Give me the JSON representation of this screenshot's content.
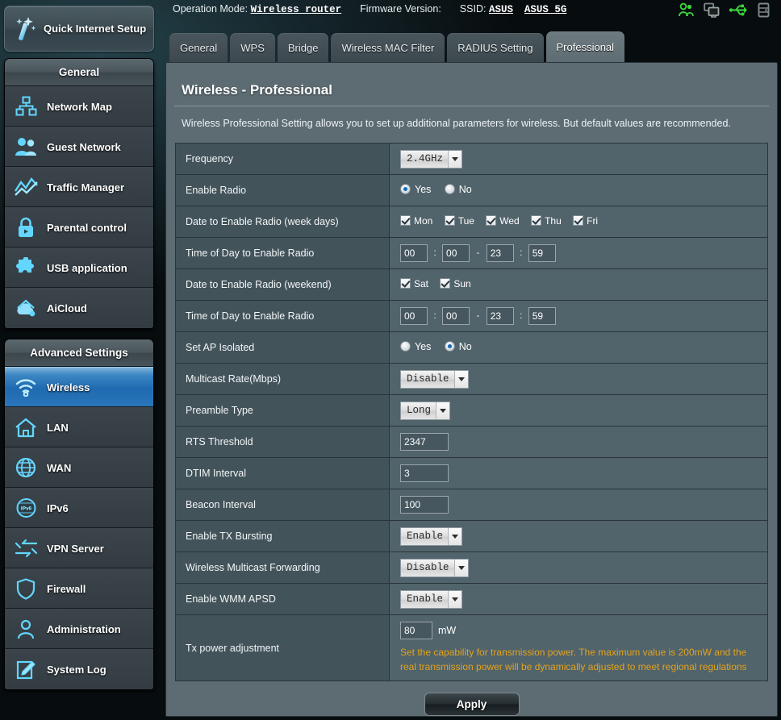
{
  "sidebar": {
    "quick_setup": {
      "label": "Quick Internet Setup",
      "icon": "magic-wand-icon"
    },
    "groups": [
      {
        "title": "General",
        "items": [
          {
            "label": "Network Map",
            "icon": "network-map-icon",
            "active": false
          },
          {
            "label": "Guest Network",
            "icon": "guest-users-icon",
            "active": false
          },
          {
            "label": "Traffic Manager",
            "icon": "traffic-chart-icon",
            "active": false
          },
          {
            "label": "Parental control",
            "icon": "padlock-icon",
            "active": false
          },
          {
            "label": "USB application",
            "icon": "puzzle-piece-icon",
            "active": false
          },
          {
            "label": "AiCloud",
            "icon": "cloud-house-icon",
            "active": false
          }
        ]
      },
      {
        "title": "Advanced Settings",
        "items": [
          {
            "label": "Wireless",
            "icon": "wifi-signal-icon",
            "active": true
          },
          {
            "label": "LAN",
            "icon": "house-icon",
            "active": false
          },
          {
            "label": "WAN",
            "icon": "globe-icon",
            "active": false
          },
          {
            "label": "IPv6",
            "icon": "ipv6-globe-icon",
            "active": false
          },
          {
            "label": "VPN Server",
            "icon": "vpn-arrows-icon",
            "active": false
          },
          {
            "label": "Firewall",
            "icon": "shield-icon",
            "active": false
          },
          {
            "label": "Administration",
            "icon": "user-badge-icon",
            "active": false
          },
          {
            "label": "System Log",
            "icon": "log-pencil-icon",
            "active": false
          }
        ]
      }
    ]
  },
  "header": {
    "operation_mode_label": "Operation Mode:",
    "operation_mode_value": "Wireless router",
    "firmware_label": "Firmware Version:",
    "firmware_value": "",
    "ssid_label": "SSID:",
    "ssid_value_1": "ASUS",
    "ssid_value_2": "ASUS_5G",
    "icons": [
      {
        "name": "clients-users-icon",
        "color": "#3bd33b"
      },
      {
        "name": "network-clients-icon",
        "color": "#7e8a8a"
      },
      {
        "name": "usb-icon",
        "color": "#3bd33b"
      },
      {
        "name": "printer-icon",
        "color": "#7e8a8a"
      }
    ]
  },
  "tabs": [
    {
      "label": "General",
      "active": false
    },
    {
      "label": "WPS",
      "active": false
    },
    {
      "label": "Bridge",
      "active": false
    },
    {
      "label": "Wireless MAC Filter",
      "active": false
    },
    {
      "label": "RADIUS Setting",
      "active": false
    },
    {
      "label": "Professional",
      "active": true
    }
  ],
  "page": {
    "title": "Wireless - Professional",
    "description": "Wireless Professional Setting allows you to set up additional parameters for wireless. But default values are recommended."
  },
  "form": {
    "frequency": {
      "label": "Frequency",
      "value": "2.4GHz"
    },
    "enable_radio": {
      "label": "Enable Radio",
      "yes": "Yes",
      "no": "No",
      "selected": "Yes"
    },
    "date_weekdays": {
      "label": "Date to Enable Radio (week days)",
      "days": [
        {
          "label": "Mon",
          "checked": true
        },
        {
          "label": "Tue",
          "checked": true
        },
        {
          "label": "Wed",
          "checked": true
        },
        {
          "label": "Thu",
          "checked": true
        },
        {
          "label": "Fri",
          "checked": true
        }
      ]
    },
    "time_weekdays": {
      "label": "Time of Day to Enable Radio",
      "start_h": "00",
      "start_m": "00",
      "end_h": "23",
      "end_m": "59",
      "colon": ":",
      "dash": "-"
    },
    "date_weekend": {
      "label": "Date to Enable Radio (weekend)",
      "days": [
        {
          "label": "Sat",
          "checked": true
        },
        {
          "label": "Sun",
          "checked": true
        }
      ]
    },
    "time_weekend": {
      "label": "Time of Day to Enable Radio",
      "start_h": "00",
      "start_m": "00",
      "end_h": "23",
      "end_m": "59",
      "colon": ":",
      "dash": "-"
    },
    "ap_isolated": {
      "label": "Set AP Isolated",
      "yes": "Yes",
      "no": "No",
      "selected": "No"
    },
    "multicast_rate": {
      "label": "Multicast Rate(Mbps)",
      "value": "Disable"
    },
    "preamble_type": {
      "label": "Preamble Type",
      "value": "Long"
    },
    "rts_threshold": {
      "label": "RTS Threshold",
      "value": "2347"
    },
    "dtim_interval": {
      "label": "DTIM Interval",
      "value": "3"
    },
    "beacon_interval": {
      "label": "Beacon Interval",
      "value": "100"
    },
    "tx_bursting": {
      "label": "Enable TX Bursting",
      "value": "Enable"
    },
    "multicast_forwarding": {
      "label": "Wireless Multicast Forwarding",
      "value": "Disable"
    },
    "wmm_apsd": {
      "label": "Enable WMM APSD",
      "value": "Enable"
    },
    "tx_power": {
      "label": "Tx power adjustment",
      "value": "80",
      "unit": "mW",
      "note": "Set the capability for transmission power. The maximum value is 200mW and the real transmission power will be dynamically adjusted to meet regional regulations"
    }
  },
  "apply": {
    "label": "Apply"
  },
  "colors": {
    "accent_blue": "#1f6ab0",
    "panel": "#5d6c72",
    "row_label": "#43535a",
    "row_value": "#51636b",
    "warning_orange": "#e3a31b",
    "icon_green": "#3bd33b"
  }
}
